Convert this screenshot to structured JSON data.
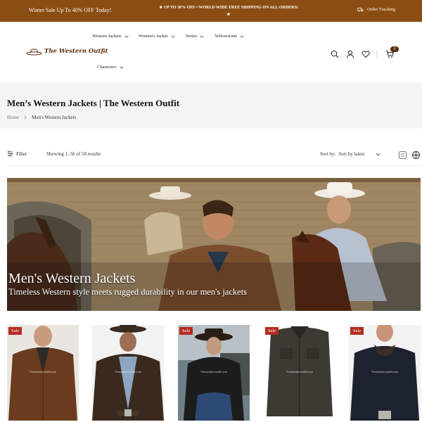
{
  "promo": {
    "left_text": "Winter Sale Up To 40% OFF Today!",
    "center_text": "★ UP TO 30% OFF • WORLD WIDE FREE SHIPPING ON ALL ORDERS! ★",
    "order_tracking": "Order Tracking"
  },
  "header": {
    "logo_text": "The Western Outfit",
    "nav": [
      {
        "label": "Western Jackets"
      },
      {
        "label": "Women's Jacket"
      },
      {
        "label": "Series"
      },
      {
        "label": "Yellowstone"
      },
      {
        "label": "Characters"
      }
    ],
    "icons": [
      "search-icon",
      "user-icon",
      "heart-icon",
      "cart-icon"
    ],
    "cart_count": "0"
  },
  "page": {
    "title": "Men’s Western Jackets | The Western Outfit",
    "breadcrumb_home": "Home",
    "breadcrumb_current": "Men's Western Jackets"
  },
  "toolbar": {
    "filter_label": "Filter",
    "showing": "Showing 1–56 of 58 results",
    "sort_label": "Sort by:",
    "sort_value": "Sort by latest"
  },
  "hero": {
    "title": "Men's Western Jackets",
    "subtitle": "Timeless Western style meets rugged durability in our men's jackets"
  },
  "products": [
    {
      "sale": "Sale",
      "watermark": "Thewesternoutfit.com",
      "jacket_color": "#6b3b1e"
    },
    {
      "sale": "",
      "watermark": "Thewesternoutfit.com",
      "jacket_color": "#3a2a1e"
    },
    {
      "sale": "Sale",
      "watermark": "Thewesternoutfit.com",
      "jacket_color": "#1c1c1c"
    },
    {
      "sale": "Sale",
      "watermark": "Thewesternoutfit.com",
      "jacket_color": "#3d3a33"
    },
    {
      "sale": "Sale",
      "watermark": "Thewesternoutfit.com",
      "jacket_color": "#1d2230"
    }
  ],
  "colors": {
    "promo_bg": "#8a4d12",
    "brand": "#5a2d0c",
    "sale_badge": "#b52a20"
  }
}
